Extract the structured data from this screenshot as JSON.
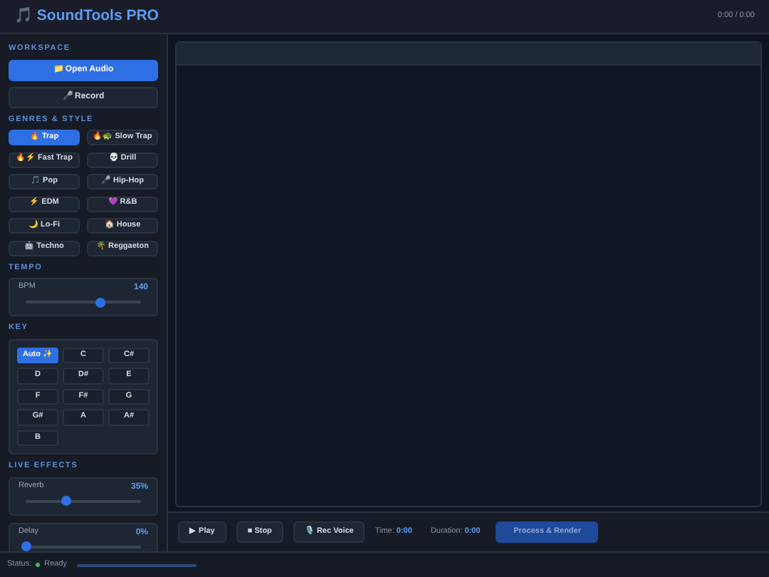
{
  "app": {
    "title": "🎵 SoundTools PRO",
    "time": "0:00 / 0:00"
  },
  "sidebar": {
    "sections": [
      {
        "kind": "workspace",
        "title": "WORKSPACE",
        "buttons": [
          {
            "label": "📁 Open Audio",
            "primary": true
          },
          {
            "label": "🎤 Record",
            "primary": false
          }
        ]
      },
      {
        "kind": "genres",
        "title": "GENRES & STYLE",
        "items": [
          {
            "label": "🔥 Trap",
            "selected": true
          },
          {
            "label": "🔥🐢 Slow Trap",
            "selected": false
          },
          {
            "label": "🔥⚡ Fast Trap",
            "selected": false
          },
          {
            "label": "💀 Drill",
            "selected": false
          },
          {
            "label": "🎵 Pop",
            "selected": false
          },
          {
            "label": "🎤 Hip-Hop",
            "selected": false
          },
          {
            "label": "⚡ EDM",
            "selected": false
          },
          {
            "label": "💜 R&B",
            "selected": false
          },
          {
            "label": "🌙 Lo-Fi",
            "selected": false
          },
          {
            "label": "🏠 House",
            "selected": false
          },
          {
            "label": "🤖 Techno",
            "selected": false
          },
          {
            "label": "🌴 Reggaeton",
            "selected": false
          }
        ]
      },
      {
        "kind": "sliders",
        "title": "TEMPO",
        "sliders": [
          {
            "label": "BPM",
            "reading": "140",
            "level": 0.65
          }
        ]
      },
      {
        "kind": "keys",
        "title": "KEY",
        "items": [
          {
            "label": "Auto ✨",
            "selected": true
          },
          {
            "label": "C",
            "selected": false
          },
          {
            "label": "C#",
            "selected": false
          },
          {
            "label": "D",
            "selected": false
          },
          {
            "label": "D#",
            "selected": false
          },
          {
            "label": "E",
            "selected": false
          },
          {
            "label": "F",
            "selected": false
          },
          {
            "label": "F#",
            "selected": false
          },
          {
            "label": "G",
            "selected": false
          },
          {
            "label": "G#",
            "selected": false
          },
          {
            "label": "A",
            "selected": false
          },
          {
            "label": "A#",
            "selected": false
          },
          {
            "label": "B",
            "selected": false
          }
        ]
      },
      {
        "kind": "sliders",
        "title": "LIVE EFFECTS",
        "sliders": [
          {
            "label": "Reverb",
            "reading": "35%",
            "level": 0.35
          },
          {
            "label": "Delay",
            "reading": "0%",
            "level": 0
          }
        ]
      }
    ]
  },
  "transport": {
    "buttons": [
      {
        "label": "▶ Play",
        "disabled": false
      },
      {
        "label": "■ Stop",
        "disabled": false
      },
      {
        "label": "🎙️ Rec Voice",
        "disabled": false
      }
    ],
    "time_label": "Time:",
    "time_value": "0:00",
    "duration_label": "Duration:",
    "duration_value": "0:00",
    "render_button": {
      "label": "Process & Render",
      "disabled": true
    }
  },
  "status_bar": {
    "label": "Status:",
    "value": "Ready",
    "ok": true
  }
}
